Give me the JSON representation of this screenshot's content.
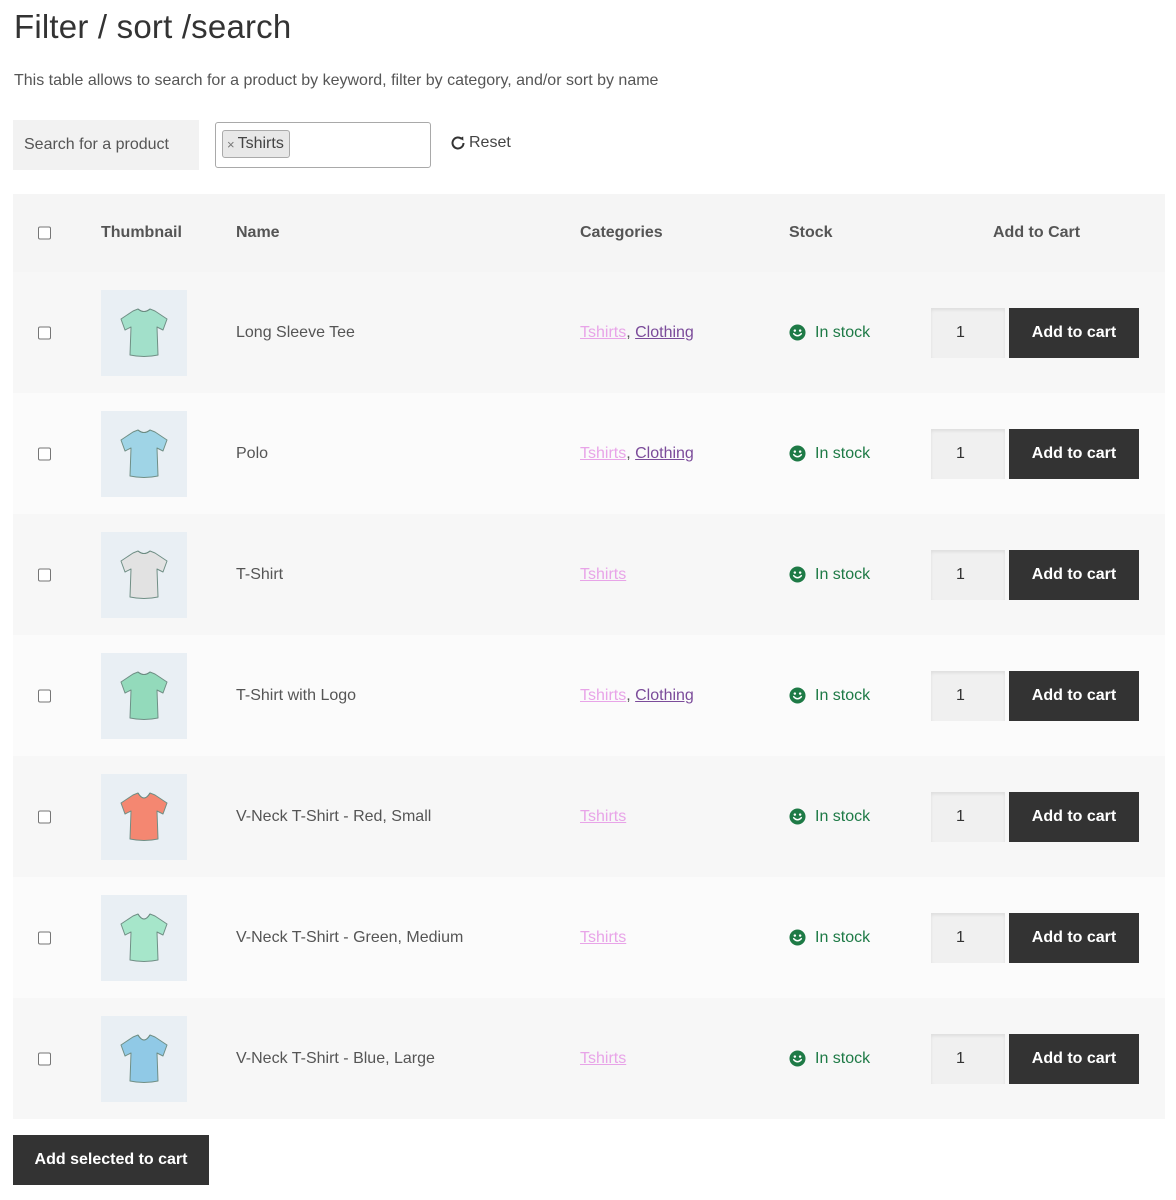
{
  "page": {
    "title": "Filter / sort /search",
    "description": "This table allows to search for a product by keyword, filter by category, and/or sort by name"
  },
  "filters": {
    "search_placeholder": "Search for a product",
    "selected_category": "Tshirts",
    "chip_remove": "×",
    "reset_label": "Reset"
  },
  "table": {
    "headers": {
      "thumbnail": "Thumbnail",
      "name": "Name",
      "categories": "Categories",
      "stock": "Stock",
      "add_to_cart": "Add to Cart"
    },
    "category_separator": ", ",
    "rows": [
      {
        "name": "Long Sleeve Tee",
        "cat1": "Tshirts",
        "cat2": "Clothing",
        "stock": "In stock",
        "qty": "1",
        "button": "Add to cart",
        "shirt_color": "#9fe0c8"
      },
      {
        "name": "Polo",
        "cat1": "Tshirts",
        "cat2": "Clothing",
        "stock": "In stock",
        "qty": "1",
        "button": "Add to cart",
        "shirt_color": "#9cd3e6"
      },
      {
        "name": "T-Shirt",
        "cat1": "Tshirts",
        "cat2": "",
        "stock": "In stock",
        "qty": "1",
        "button": "Add to cart",
        "shirt_color": "#e2e2e2"
      },
      {
        "name": "T-Shirt with Logo",
        "cat1": "Tshirts",
        "cat2": "Clothing",
        "stock": "In stock",
        "qty": "1",
        "button": "Add to cart",
        "shirt_color": "#8fd9b8"
      },
      {
        "name": "V-Neck T-Shirt - Red, Small",
        "cat1": "Tshirts",
        "cat2": "",
        "stock": "In stock",
        "qty": "1",
        "button": "Add to cart",
        "shirt_color": "#f5826b"
      },
      {
        "name": "V-Neck T-Shirt - Green, Medium",
        "cat1": "Tshirts",
        "cat2": "",
        "stock": "In stock",
        "qty": "1",
        "button": "Add to cart",
        "shirt_color": "#a3e6c8"
      },
      {
        "name": "V-Neck T-Shirt - Blue, Large",
        "cat1": "Tshirts",
        "cat2": "",
        "stock": "In stock",
        "qty": "1",
        "button": "Add to cart",
        "shirt_color": "#8cc7e6"
      }
    ]
  },
  "footer": {
    "add_selected_label": "Add selected to cart"
  },
  "colors": {
    "stock_green": "#1e7a46",
    "tshirts_link": "#e8a4e8",
    "clothing_link": "#7b4b9a",
    "button_dark": "#333333"
  },
  "icons": {
    "reset": "refresh-icon",
    "stock": "smile-icon",
    "chip_remove": "close-icon"
  }
}
